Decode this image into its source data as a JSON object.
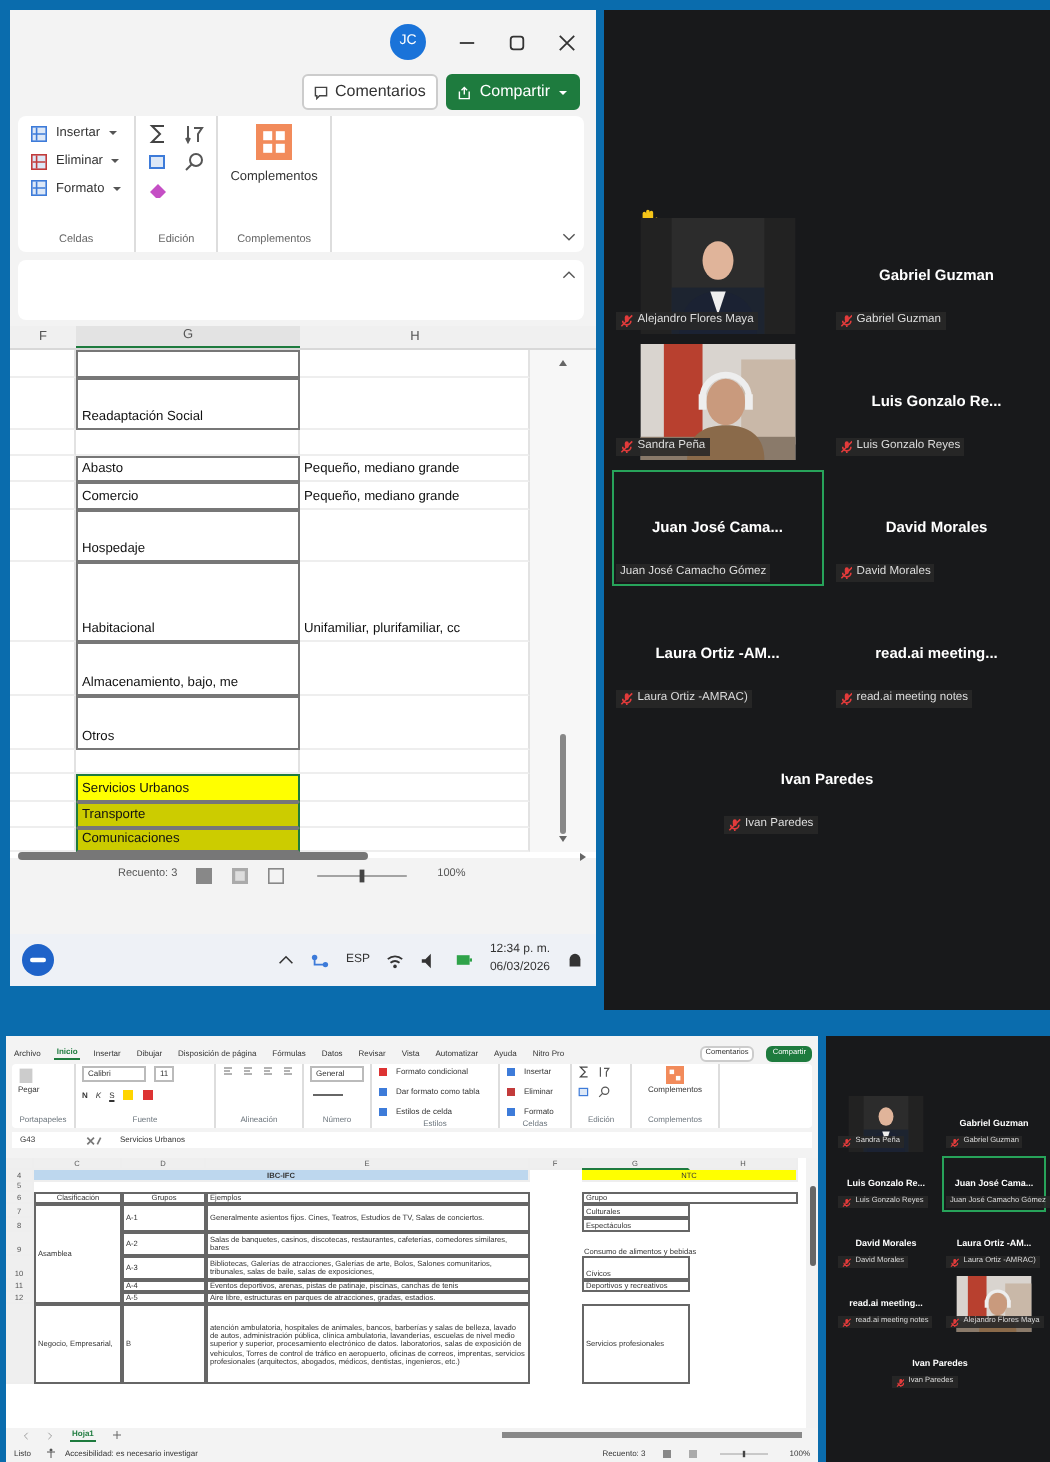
{
  "top": {
    "excel": {
      "avatar": "JC",
      "comments_button": "Comentarios",
      "share_button": "Compartir",
      "ribbon_groups": [
        {
          "kind": "list",
          "label": "Celdas",
          "items": [
            "Insertar",
            "Eliminar",
            "Formato"
          ]
        },
        {
          "kind": "icons",
          "label": "Edición"
        },
        {
          "kind": "big",
          "label": "Complementos",
          "items": [
            "Complementos"
          ]
        }
      ],
      "columns": [
        "F",
        "G",
        "H"
      ],
      "rows": [
        {
          "kind": "cell",
          "selected": false
        },
        {
          "kind": "cell",
          "g": "Readaptación Social",
          "selected": false
        },
        {
          "kind": "gap"
        },
        {
          "kind": "cell",
          "g": "Abasto",
          "h": "Pequeño, mediano grande",
          "selected": false
        },
        {
          "kind": "cell",
          "g": "Comercio",
          "h": "Pequeño, mediano grande",
          "selected": false
        },
        {
          "kind": "cell",
          "g": "Hospedaje",
          "selected": false
        },
        {
          "kind": "cell",
          "g": "Habitacional",
          "h": "Unifamiliar, plurifamiliar, cc",
          "selected": false
        },
        {
          "kind": "cell",
          "g": "Almacenamiento, bajo, me",
          "selected": false
        },
        {
          "kind": "cell",
          "g": "Otros",
          "selected": false
        },
        {
          "kind": "gap"
        },
        {
          "kind": "cell",
          "g": "Servicios Urbanos",
          "color": "#ffff00",
          "selected": true
        },
        {
          "kind": "cell",
          "g": "Transporte",
          "color": "#cccc00",
          "selected": true
        },
        {
          "kind": "cell",
          "g": "Comunicaciones",
          "color": "#cccc00",
          "selected": true
        }
      ],
      "status": {
        "count": "Recuento: 3",
        "zoom": "100%",
        "level": 0.5
      }
    },
    "taskbar": {
      "language": "ESP",
      "time": "12:34 p. m.",
      "date": "06/03/2026"
    },
    "meeting": {
      "hand_raised": true,
      "tiles": [
        {
          "label": "Alejandro Flores Maya",
          "muted": true,
          "speaking": false
        },
        {
          "kind": "name",
          "name": "Gabriel Guzman",
          "label": "Gabriel Guzman",
          "muted": true,
          "speaking": false
        },
        {
          "label": "Sandra Peña",
          "muted": true,
          "speaking": false
        },
        {
          "kind": "name",
          "name": "Luis Gonzalo Re...",
          "label": "Luis Gonzalo Reyes",
          "muted": true,
          "speaking": false
        },
        {
          "kind": "name",
          "name": "Juan José Cama...",
          "label": "Juan José Camacho Gómez",
          "muted": false,
          "speaking": true
        },
        {
          "kind": "name",
          "name": "David Morales",
          "label": "David Morales",
          "muted": true,
          "speaking": false
        },
        {
          "kind": "name",
          "name": "Laura Ortiz -AM...",
          "label": "Laura Ortiz -AMRAC)",
          "muted": true,
          "speaking": false
        },
        {
          "kind": "name",
          "name": "read.ai meeting...",
          "label": "read.ai meeting notes",
          "muted": true,
          "speaking": false
        },
        {
          "kind": "name",
          "name": "Ivan Paredes",
          "label": "Ivan Paredes",
          "muted": true,
          "speaking": false
        }
      ]
    }
  },
  "bottom": {
    "excel": {
      "menu": [
        {
          "label": "Archivo",
          "selected": false
        },
        {
          "label": "Inicio",
          "selected": true
        },
        {
          "label": "Insertar",
          "selected": false
        },
        {
          "label": "Dibujar",
          "selected": false
        },
        {
          "label": "Disposición de página",
          "selected": false
        },
        {
          "label": "Fórmulas",
          "selected": false
        },
        {
          "label": "Datos",
          "selected": false
        },
        {
          "label": "Revisar",
          "selected": false
        },
        {
          "label": "Vista",
          "selected": false
        },
        {
          "label": "Automatizar",
          "selected": false
        },
        {
          "label": "Ayuda",
          "selected": false
        },
        {
          "label": "Nitro Pro",
          "selected": false
        }
      ],
      "comments_button": "Comentarios",
      "share_button": "Compartir",
      "ribbon": {
        "paste": "Pegar",
        "font": "Calibri",
        "size": "11",
        "font_style_buttons": [
          "N",
          "K",
          "S"
        ],
        "number_format": "General",
        "styles": [
          "Formato condicional",
          "Dar formato como tabla",
          "Estilos de celda"
        ],
        "cells": [
          "Insertar",
          "Eliminar",
          "Formato"
        ],
        "addins": "Complementos",
        "group_labels": [
          "Portapapeles",
          "Fuente",
          "Alineación",
          "Número",
          "Estilos",
          "Celdas",
          "Edición",
          "Complementos"
        ]
      },
      "name_box": "G43",
      "formula": "Servicios Urbanos",
      "columns": [
        "C",
        "D",
        "E",
        "F",
        "G",
        "H"
      ],
      "row_numbers": [
        "4",
        "5",
        "6",
        "7",
        "8",
        "9",
        "10",
        "11",
        "12"
      ],
      "title_left": "IBC-IFC",
      "title_right": "NTC",
      "table_header": [
        "Clasificación",
        "Grupos",
        "Ejemplos"
      ],
      "groups_header": "Grupo",
      "classes": [
        {
          "label": "Asamblea",
          "groups": [
            {
              "code": "A-1",
              "examples": "Generalmente asientos fijos. Cines, Teatros, Estudios de TV, Salas de conciertos."
            },
            {
              "code": "A-2",
              "examples": "Salas de banquetes, casinos, discotecas, restaurantes, cafeterías, comedores similares, bares"
            },
            {
              "code": "A-3",
              "examples": "Bibliotecas, Galerías de atracciones, Galerías de arte, Bolos, Salones comunitarios, tribunales, salas de baile, salas de exposiciones,"
            },
            {
              "code": "A-4",
              "examples": "Eventos deportivos, arenas, pistas de patinaje, piscinas, canchas de tenis"
            },
            {
              "code": "A-5",
              "examples": "Aire libre, estructuras en parques de atracciones, gradas, estadios."
            }
          ]
        },
        {
          "label": "Negocio, Empresarial,",
          "groups": [
            {
              "code": "B",
              "examples": "atención ambulatoria, hospitales de animales, bancos, barberías y salas de belleza, lavado de autos, administración pública, clínica ambulatoria, lavanderías, escuelas de nivel medio superior y superior, procesamiento electrónico de datos. laboratorios, salas de exposición de vehículos, Torres de control de tráfico en aeropuerto, oficinas de correos, imprentas, servicios profesionales (arquitectos, abogados, médicos, dentistas, ingenieros, etc.)"
            }
          ]
        }
      ],
      "ntc_groups": [
        "Culturales",
        "Espectáculos",
        "Consumo de alimentos y bebidas",
        "Cívicos",
        "Deportivos y recreativos",
        "Servicios profesionales"
      ],
      "sheet_tabs": [
        {
          "label": "Hoja1",
          "selected": true
        }
      ],
      "status": {
        "ready": "Listo",
        "accessibility": "Accesibilidad: es necesario investigar",
        "count": "Recuento: 3",
        "zoom": "100%",
        "level": 0.5
      }
    },
    "meeting": {
      "tiles": [
        {
          "label": "Sandra Peña",
          "muted": true,
          "speaking": false
        },
        {
          "kind": "name",
          "name": "Gabriel Guzman",
          "label": "Gabriel Guzman",
          "muted": true,
          "speaking": false
        },
        {
          "kind": "name",
          "name": "Luis Gonzalo Re...",
          "label": "Luis Gonzalo Reyes",
          "muted": true,
          "speaking": false
        },
        {
          "kind": "name",
          "name": "Juan José Cama...",
          "label": "Juan José Camacho Gómez",
          "muted": false,
          "speaking": true
        },
        {
          "kind": "name",
          "name": "David Morales",
          "label": "David Morales",
          "muted": true,
          "speaking": false
        },
        {
          "kind": "name",
          "name": "Laura Ortiz -AM...",
          "label": "Laura Ortiz -AMRAC)",
          "muted": true,
          "speaking": false
        },
        {
          "kind": "name",
          "name": "read.ai meeting...",
          "label": "read.ai meeting notes",
          "muted": true,
          "speaking": false
        },
        {
          "label": "Alejandro Flores Maya",
          "muted": true,
          "speaking": false
        },
        {
          "kind": "name",
          "name": "Ivan Paredes",
          "label": "Ivan Paredes",
          "muted": true,
          "speaking": false
        }
      ]
    }
  }
}
